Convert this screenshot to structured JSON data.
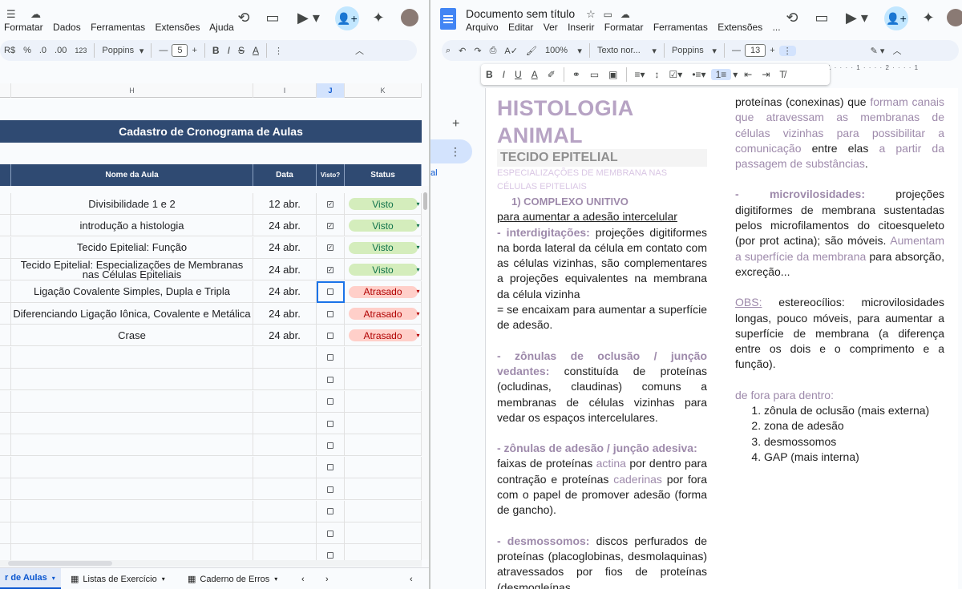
{
  "sheets": {
    "menu": [
      "Formatar",
      "Dados",
      "Ferramentas",
      "Extensões",
      "Ajuda"
    ],
    "toolbar": {
      "currency": "R$",
      "percent": "%",
      "dec_less": ".0",
      "dec_more": ".00",
      "number_format": "123",
      "font": "Poppins",
      "font_size": "5"
    },
    "columns": [
      "H",
      "I",
      "J",
      "K"
    ],
    "title": "Cadastro de Cronograma de Aulas",
    "headers": {
      "name": "Nome da Aula",
      "date": "Data",
      "seen": "Visto?",
      "status": "Status"
    },
    "rows": [
      {
        "name": "Divisibilidade 1 e 2",
        "date": "12 abr.",
        "checked": true,
        "status": "Visto",
        "status_type": "visto"
      },
      {
        "name": "introdução a histologia",
        "date": "24 abr.",
        "checked": true,
        "status": "Visto",
        "status_type": "visto"
      },
      {
        "name": "Tecido Epitelial: Função",
        "date": "24 abr.",
        "checked": true,
        "status": "Visto",
        "status_type": "visto"
      },
      {
        "name": "Tecido Epitelial: Especializações de Membranas nas Células Epiteliais",
        "date": "24 abr.",
        "checked": true,
        "status": "Visto",
        "status_type": "visto"
      },
      {
        "name": "Ligação Covalente Simples, Dupla e Tripla",
        "date": "24 abr.",
        "checked": false,
        "status": "Atrasado",
        "status_type": "atr"
      },
      {
        "name": "Diferenciando Ligação Iônica, Covalente e Metálica",
        "date": "24 abr.",
        "checked": false,
        "status": "Atrasado",
        "status_type": "atr"
      },
      {
        "name": "Crase",
        "date": "24 abr.",
        "checked": false,
        "status": "Atrasado",
        "status_type": "atr"
      }
    ],
    "empty_rows": 10,
    "tabs": [
      "r de Aulas",
      "Listas de Exercício",
      "Caderno de Erros"
    ],
    "colors": {
      "header_bg": "#2f4a72",
      "visto_bg": "#d4edbc",
      "atrasado_bg": "#ffcfc9"
    }
  },
  "docs": {
    "title": "Documento sem título",
    "menu": [
      "Arquivo",
      "Editar",
      "Ver",
      "Inserir",
      "Formatar",
      "Ferramentas",
      "Extensões",
      "..."
    ],
    "toolbar": {
      "zoom": "100%",
      "style": "Texto nor...",
      "font": "Poppins",
      "font_size": "13"
    },
    "ruler": "1 · · · · 1 · · · · 2 · · · · 1",
    "left_col": {
      "h1": "HISTOLOGIA ANIMAL",
      "h2": "TECIDO EPITELIAL",
      "h3": "ESPECIALIZAÇÕES DE MEMBRANA NAS CÉLULAS EPITELIAIS",
      "h4": "1)  COMPLEXO UNITIVO",
      "sub": "para aumentar a adesão intercelular",
      "interdig_label": "-  interdigitações:",
      "interdig_text": " projeções digitiformes na borda lateral da célula em contato com as células vizinhas, são complementares a projeções equivalentes na membrana da célula vizinha",
      "interdig_eq": "= se encaixam para aumentar a superfície de adesão.",
      "zonulas_label": "-  zônulas de oclusão / junção vedantes:",
      "zonulas_text": " constituída de proteínas (ocludinas, claudinas) comuns a membranas de células vizinhas para vedar os espaços intercelulares.",
      "adesao_label": "- zônulas de adesão / junção adesiva:",
      "adesao_t1": "faixas de proteínas ",
      "adesao_p1": "actina",
      "adesao_t2": " por dentro para contração e proteínas ",
      "adesao_p2": "caderinas",
      "adesao_t3": " por fora com o papel de promover adesão (forma de gancho).",
      "desmo_label": "- desmossomos:",
      "desmo_text": " discos perfurados de proteínas (placoglobinas, desmolaquinas) atravessados por fios de proteínas (desmogleínas..."
    },
    "right_col": {
      "gap_t1": "proteínas (conexinas) que ",
      "gap_p1": "formam canais que atravessam as membranas de células vizinhas para possibilitar a comunicação",
      "gap_t2": " entre elas ",
      "gap_p2": "a partir da passagem de substâncias",
      "gap_t3": ".",
      "micro_label": "-  microvilosidades:",
      "micro_text": " projeções digitiformes de membrana sustentadas pelos microfilamentos do citoesqueleto (por prot actina); são móveis. ",
      "micro_p": "Aumentam a superfície da membrana",
      "micro_t2": " para absorção, excreção...",
      "obs_label": "OBS:",
      "obs_text": " estereocílios: microvilosidades longas, pouco móveis, para aumentar a superfície de membrana (a diferença entre os dois e o comprimento e a função).",
      "order_label": "de fora para dentro:",
      "order_list": [
        "zônula de oclusão (mais externa)",
        "zona de adesão",
        "desmossomos",
        "GAP (mais interna)"
      ]
    }
  }
}
